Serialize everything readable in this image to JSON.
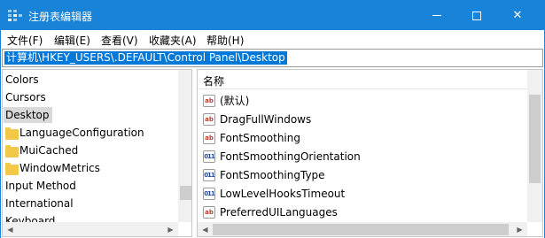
{
  "window": {
    "title": "注册表编辑器",
    "accent_color": "#1883d7",
    "min_icon": "minimize-icon",
    "max_icon": "maximize-icon",
    "close_label": "✕"
  },
  "menubar": {
    "items": [
      {
        "label": "文件(F)"
      },
      {
        "label": "编辑(E)"
      },
      {
        "label": "查看(V)"
      },
      {
        "label": "收藏夹(A)"
      },
      {
        "label": "帮助(H)"
      }
    ]
  },
  "address": {
    "path": "计算机\\HKEY_USERS\\.DEFAULT\\Control Panel\\Desktop"
  },
  "tree": {
    "items": [
      {
        "label": "Colors",
        "folder": false
      },
      {
        "label": "Cursors",
        "folder": false
      },
      {
        "label": "Desktop",
        "folder": false,
        "selected": true
      },
      {
        "label": "LanguageConfiguration",
        "folder": true
      },
      {
        "label": "MuiCached",
        "folder": true
      },
      {
        "label": "WindowMetrics",
        "folder": true
      },
      {
        "label": "Input Method",
        "folder": false
      },
      {
        "label": "International",
        "folder": false
      },
      {
        "label": "Keyboard",
        "folder": false
      }
    ]
  },
  "values": {
    "column_name": "名称",
    "rows": [
      {
        "name": "(默认)",
        "icon": "ab"
      },
      {
        "name": "DragFullWindows",
        "icon": "ab"
      },
      {
        "name": "FontSmoothing",
        "icon": "ab"
      },
      {
        "name": "FontSmoothingOrientation",
        "icon": "binary"
      },
      {
        "name": "FontSmoothingType",
        "icon": "binary"
      },
      {
        "name": "LowLevelHooksTimeout",
        "icon": "binary"
      },
      {
        "name": "PreferredUILanguages",
        "icon": "ab"
      }
    ]
  },
  "icons": {
    "string_value_glyph": "ab",
    "binary_value_glyph": "011"
  }
}
